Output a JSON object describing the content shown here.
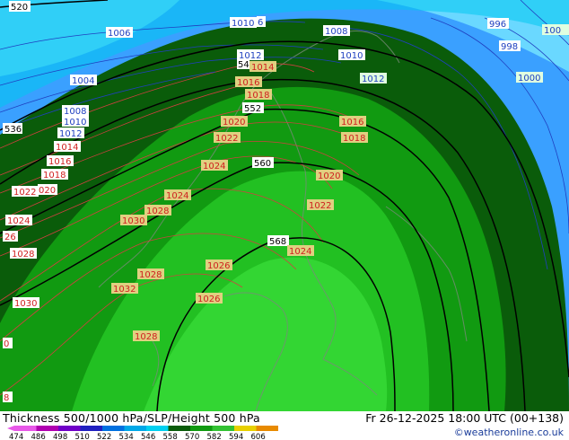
{
  "map": {
    "title": "Thickness 500/1000 hPa/SLP/Height 500 hPa",
    "valid_time": "Fr 26-12-2025 18:00 UTC (00+138)",
    "credit": "©weatheronline.co.uk",
    "colors": {
      "thickness_dark": "#0a5c0a",
      "thickness_mid": "#119a11",
      "thickness_light": "#22c022",
      "thickness_bright": "#33d633",
      "cold_cyan": "#00c8f0",
      "cold_blue": "#3aa0ff",
      "cold_lightcyan": "#6ad8ff",
      "slp_high": "#e04040",
      "slp_low": "#2040d0",
      "height_line": "#000000"
    },
    "legend": {
      "values": [
        "474",
        "486",
        "498",
        "510",
        "522",
        "534",
        "546",
        "558",
        "570",
        "582",
        "594",
        "606"
      ],
      "colors": [
        "#e858e8",
        "#b000b0",
        "#7000c8",
        "#2020c0",
        "#0070e0",
        "#00a8e8",
        "#00d0f0",
        "#0a5c0a",
        "#119a11",
        "#33c233",
        "#e8d000",
        "#e88a00"
      ]
    },
    "height_labels": [
      {
        "text": "520"
      },
      {
        "text": "536"
      },
      {
        "text": "54"
      },
      {
        "text": "552"
      },
      {
        "text": "560"
      },
      {
        "text": "568"
      }
    ],
    "slp_high_labels": [
      {
        "text": "1014"
      },
      {
        "text": "1016"
      },
      {
        "text": "1018"
      },
      {
        "text": "1022"
      },
      {
        "text": "020"
      },
      {
        "text": "1024"
      },
      {
        "text": "26"
      },
      {
        "text": "1028"
      },
      {
        "text": "1030"
      },
      {
        "text": "0"
      },
      {
        "text": "8"
      },
      {
        "text": "1014"
      },
      {
        "text": "1016"
      },
      {
        "text": "1018"
      },
      {
        "text": "1020"
      },
      {
        "text": "1022"
      },
      {
        "text": "1024"
      },
      {
        "text": "1024"
      },
      {
        "text": "1028"
      },
      {
        "text": "1030"
      },
      {
        "text": "1026"
      },
      {
        "text": "1028"
      },
      {
        "text": "1032"
      },
      {
        "text": "1026"
      },
      {
        "text": "1028"
      },
      {
        "text": "1030"
      },
      {
        "text": "1016"
      },
      {
        "text": "1018"
      },
      {
        "text": "1020"
      },
      {
        "text": "1022"
      },
      {
        "text": "1024"
      }
    ],
    "slp_low_labels": [
      {
        "text": "1006"
      },
      {
        "text": "1004"
      },
      {
        "text": "1008"
      },
      {
        "text": "1010"
      },
      {
        "text": "1012"
      },
      {
        "text": "1010"
      },
      {
        "text": "6"
      },
      {
        "text": "1008"
      },
      {
        "text": "1012"
      },
      {
        "text": "1010"
      },
      {
        "text": "1012"
      },
      {
        "text": "996"
      },
      {
        "text": "998"
      },
      {
        "text": "1000"
      },
      {
        "text": "100"
      }
    ]
  }
}
